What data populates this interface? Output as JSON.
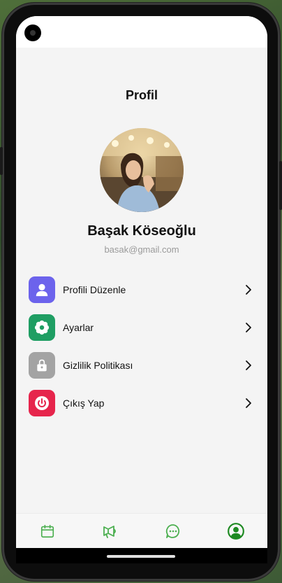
{
  "header": {
    "title": "Profil"
  },
  "profile": {
    "name": "Başak Köseoğlu",
    "email": "basak@gmail.com"
  },
  "menu": {
    "items": [
      {
        "label": "Profili Düzenle",
        "icon": "user-icon",
        "color": "#6c63ec"
      },
      {
        "label": "Ayarlar",
        "icon": "gear-icon",
        "color": "#1f9e63"
      },
      {
        "label": "Gizlilik Politikası",
        "icon": "lock-icon",
        "color": "#a3a3a3"
      },
      {
        "label": "Çıkış Yap",
        "icon": "power-icon",
        "color": "#e6254c"
      }
    ]
  },
  "bottom_nav": {
    "active_color": "#1e8a22",
    "color": "#4caf50",
    "items": [
      "calendar-icon",
      "megaphone-icon",
      "chat-icon",
      "profile-icon"
    ],
    "active": "profile-icon"
  }
}
